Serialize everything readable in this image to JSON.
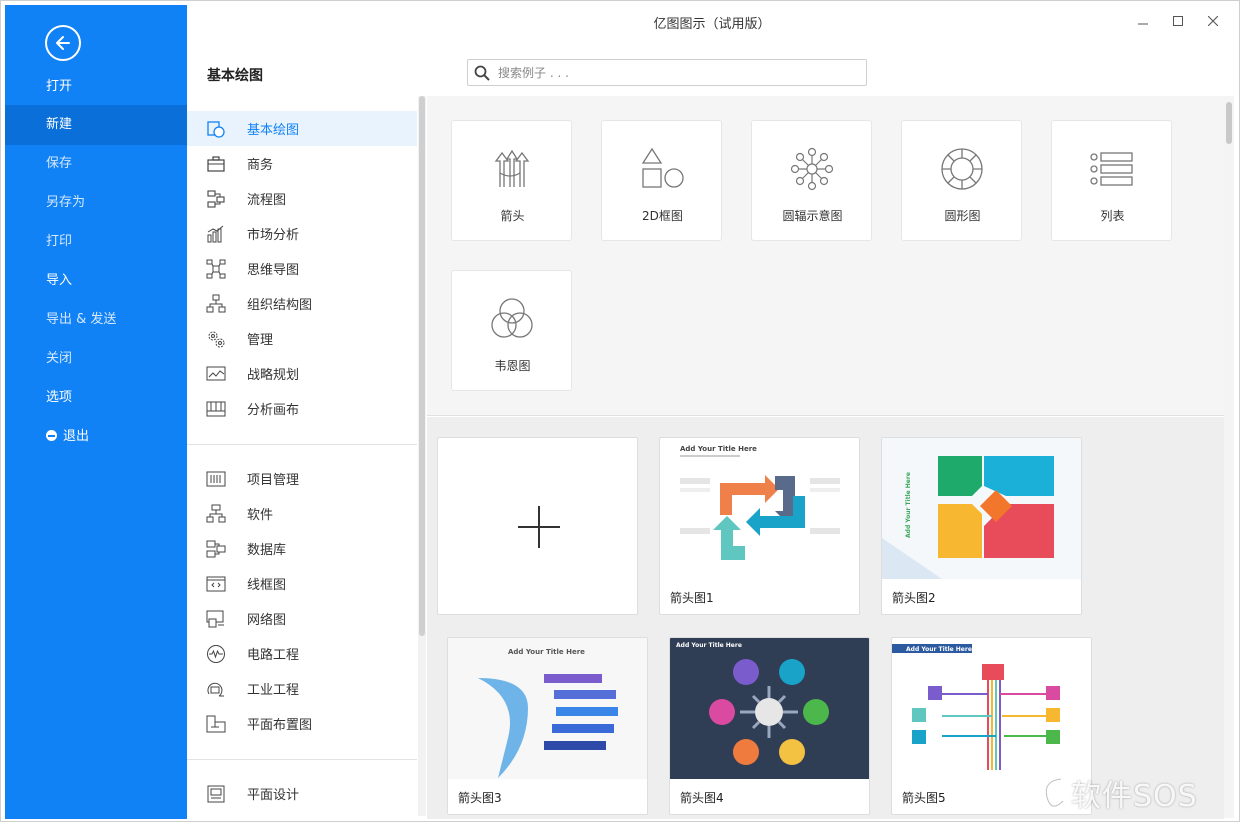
{
  "window": {
    "title": "亿图图示（试用版）"
  },
  "menu": {
    "items": [
      {
        "label": "打开"
      },
      {
        "label": "新建"
      },
      {
        "label": "保存"
      },
      {
        "label": "另存为"
      },
      {
        "label": "打印"
      },
      {
        "label": "导入"
      },
      {
        "label": "导出 & 发送"
      },
      {
        "label": "关闭"
      },
      {
        "label": "选项"
      },
      {
        "label": "退出"
      }
    ],
    "active": "新建"
  },
  "header": {
    "section_title": "基本绘图",
    "search_placeholder": "搜索例子 . . ."
  },
  "categories": {
    "group1": [
      {
        "label": "基本绘图",
        "icon": "basic-drawing-icon"
      },
      {
        "label": "商务",
        "icon": "briefcase-icon"
      },
      {
        "label": "流程图",
        "icon": "flowchart-icon"
      },
      {
        "label": "市场分析",
        "icon": "bar-chart-icon"
      },
      {
        "label": "思维导图",
        "icon": "mindmap-icon"
      },
      {
        "label": "组织结构图",
        "icon": "org-chart-icon"
      },
      {
        "label": "管理",
        "icon": "gears-icon"
      },
      {
        "label": "战略规划",
        "icon": "strategy-icon"
      },
      {
        "label": "分析画布",
        "icon": "canvas-icon"
      }
    ],
    "group2": [
      {
        "label": "项目管理",
        "icon": "project-icon"
      },
      {
        "label": "软件",
        "icon": "software-icon"
      },
      {
        "label": "数据库",
        "icon": "database-icon"
      },
      {
        "label": "线框图",
        "icon": "wireframe-icon"
      },
      {
        "label": "网络图",
        "icon": "network-icon"
      },
      {
        "label": "电路工程",
        "icon": "circuit-icon"
      },
      {
        "label": "工业工程",
        "icon": "industrial-icon"
      },
      {
        "label": "平面布置图",
        "icon": "floorplan-icon"
      }
    ],
    "group3": [
      {
        "label": "平面设计",
        "icon": "graphic-design-icon"
      }
    ]
  },
  "templates": [
    {
      "label": "箭头",
      "icon": "arrows-icon"
    },
    {
      "label": "2D框图",
      "icon": "shapes-2d-icon"
    },
    {
      "label": "圆辐示意图",
      "icon": "radial-icon"
    },
    {
      "label": "圆形图",
      "icon": "circular-icon"
    },
    {
      "label": "列表",
      "icon": "list-icon"
    },
    {
      "label": "韦恩图",
      "icon": "venn-icon"
    }
  ],
  "examples": [
    {
      "label": "箭头图1",
      "thumb_title": "Add Your Title Here"
    },
    {
      "label": "箭头图2",
      "thumb_title": "Add Your Title Here"
    },
    {
      "label": "箭头图3",
      "thumb_title": "Add Your Title Here"
    },
    {
      "label": "箭头图4",
      "thumb_title": "Add Your Title Here"
    },
    {
      "label": "箭头图5",
      "thumb_title": "Add Your Title Here"
    }
  ],
  "watermark": "软件SOS",
  "colors": {
    "nav_blue": "#1182f6",
    "nav_active": "#0a6fd8"
  }
}
